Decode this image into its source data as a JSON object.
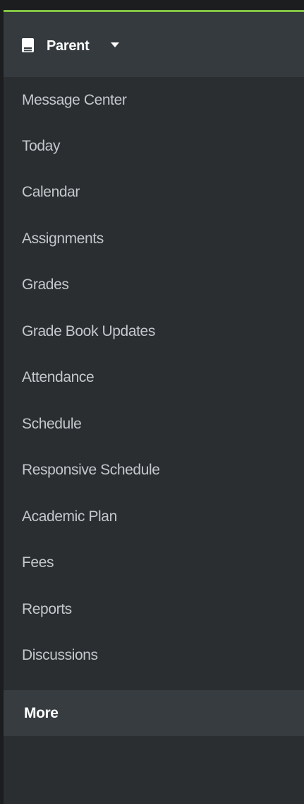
{
  "colors": {
    "accent": "#82c341",
    "sidebar_bg": "#2a2e31",
    "header_bg": "#343a3e",
    "active_bg": "#363c40",
    "label": "#c4c8cc",
    "label_active": "#ffffff"
  },
  "header": {
    "icon": "book-icon",
    "role_label": "Parent",
    "dropdown_icon": "caret-down-icon"
  },
  "nav": {
    "items": [
      {
        "label": "Message Center"
      },
      {
        "label": "Today"
      },
      {
        "label": "Calendar"
      },
      {
        "label": "Assignments"
      },
      {
        "label": "Grades"
      },
      {
        "label": "Grade Book Updates"
      },
      {
        "label": "Attendance"
      },
      {
        "label": "Schedule"
      },
      {
        "label": "Responsive Schedule"
      },
      {
        "label": "Academic Plan"
      },
      {
        "label": "Fees"
      },
      {
        "label": "Reports"
      },
      {
        "label": "Discussions"
      },
      {
        "label": "More",
        "active": true
      }
    ]
  }
}
